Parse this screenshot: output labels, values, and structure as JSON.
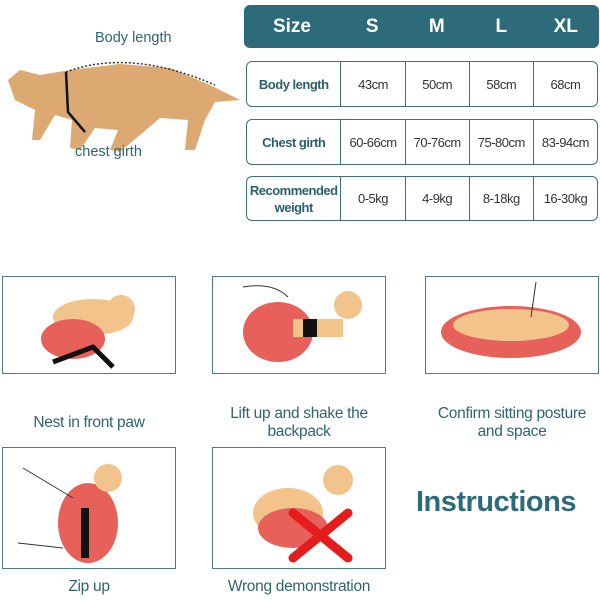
{
  "diagram": {
    "body_length_label": "Body length",
    "chest_girth_label": "chest girth"
  },
  "size_table": {
    "header": [
      "Size",
      "S",
      "M",
      "L",
      "XL"
    ],
    "rows": [
      {
        "label": "Body length",
        "values": [
          "43cm",
          "50cm",
          "58cm",
          "68cm"
        ]
      },
      {
        "label": "Chest girth",
        "values": [
          "60-66cm",
          "70-76cm",
          "75-80cm",
          "83-94cm"
        ]
      },
      {
        "label": "Recommended weight",
        "values": [
          "0-5kg",
          "4-9kg",
          "8-18kg",
          "16-30kg"
        ]
      }
    ]
  },
  "steps": [
    {
      "caption": "Nest in front paw"
    },
    {
      "caption": "Lift up and shake the backpack"
    },
    {
      "caption": "Confirm sitting posture and space"
    },
    {
      "caption": "Zip up"
    },
    {
      "caption": "Wrong demonstration"
    }
  ],
  "title": "Instructions",
  "colors": {
    "teal": "#2d6b7b",
    "bag": "#e8605a",
    "dog": "#f2c48b",
    "wrong_mark": "#e41c1c"
  }
}
